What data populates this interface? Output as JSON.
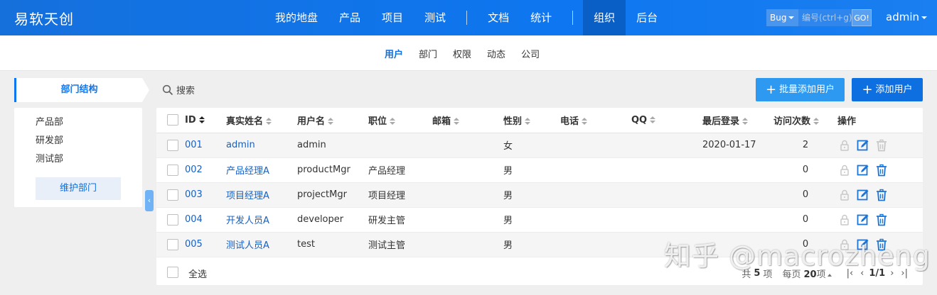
{
  "header": {
    "logo": "易软天创",
    "nav": [
      "我的地盘",
      "产品",
      "项目",
      "测试",
      "文档",
      "统计",
      "组织",
      "后台"
    ],
    "active_nav": "组织",
    "search": {
      "type": "Bug",
      "placeholder": "编号(ctrl+g)",
      "go_label": "GO!"
    },
    "user": "admin"
  },
  "subnav": {
    "items": [
      "用户",
      "部门",
      "权限",
      "动态",
      "公司"
    ],
    "active": "用户"
  },
  "sidebar": {
    "title": "部门结构",
    "departments": [
      "产品部",
      "研发部",
      "测试部"
    ],
    "maintain_button": "维护部门",
    "collapse_icon": "chevron-left-icon"
  },
  "toolbar": {
    "search_label": "搜索",
    "batch_add_label": "批量添加用户",
    "add_label": "添加用户"
  },
  "table": {
    "columns": [
      "ID",
      "真实姓名",
      "用户名",
      "职位",
      "邮箱",
      "性别",
      "电话",
      "QQ",
      "最后登录",
      "访问次数",
      "操作"
    ],
    "sorted_column": "ID",
    "rows": [
      {
        "id": "001",
        "realname": "admin",
        "account": "admin",
        "role": "",
        "email": "",
        "gender": "女",
        "phone": "",
        "qq": "",
        "last_login": "2020-01-17",
        "visits": "2",
        "deletable": false
      },
      {
        "id": "002",
        "realname": "产品经理A",
        "account": "productMgr",
        "role": "产品经理",
        "email": "",
        "gender": "男",
        "phone": "",
        "qq": "",
        "last_login": "",
        "visits": "0",
        "deletable": true
      },
      {
        "id": "003",
        "realname": "项目经理A",
        "account": "projectMgr",
        "role": "项目经理",
        "email": "",
        "gender": "男",
        "phone": "",
        "qq": "",
        "last_login": "",
        "visits": "0",
        "deletable": true
      },
      {
        "id": "004",
        "realname": "开发人员A",
        "account": "developer",
        "role": "研发主管",
        "email": "",
        "gender": "男",
        "phone": "",
        "qq": "",
        "last_login": "",
        "visits": "0",
        "deletable": true
      },
      {
        "id": "005",
        "realname": "测试人员A",
        "account": "test",
        "role": "测试主管",
        "email": "",
        "gender": "男",
        "phone": "",
        "qq": "",
        "last_login": "",
        "visits": "0",
        "deletable": true
      }
    ],
    "select_all_label": "全选"
  },
  "pager": {
    "total_prefix": "共",
    "total": "5",
    "total_suffix": "项",
    "per_page_prefix": "每页",
    "per_page": "20",
    "per_page_suffix": "项",
    "page": "1/1"
  },
  "watermark": "知乎 @macrozheng",
  "colors": {
    "primary": "#0e6fe0",
    "accent": "#2d99f0",
    "header": "#0e76f0"
  }
}
